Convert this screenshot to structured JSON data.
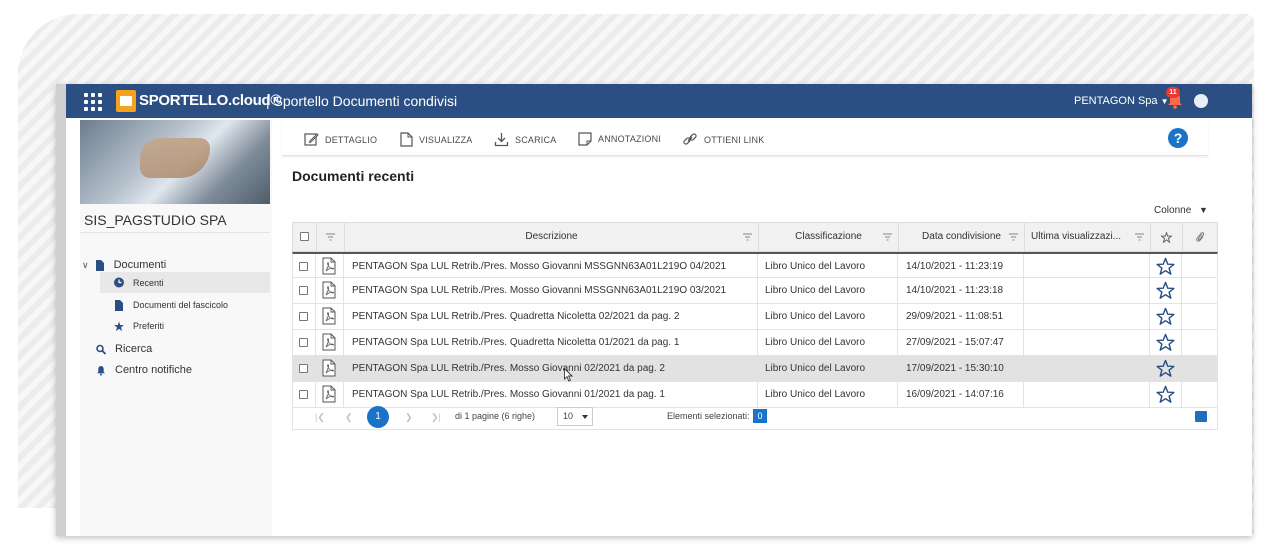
{
  "header": {
    "brand": "SPORTELLO.cloud®",
    "app_title": "| Sportello Documenti condivisi",
    "company": "PENTAGON Spa",
    "notification_count": "11"
  },
  "sidebar": {
    "company_name": "SIS_PAGSTUDIO SPA",
    "items": [
      {
        "label": "Documenti"
      },
      {
        "label": "Recenti"
      },
      {
        "label": "Documenti del fascicolo"
      },
      {
        "label": "Preferiti"
      },
      {
        "label": "Ricerca"
      },
      {
        "label": "Centro notifiche"
      }
    ]
  },
  "toolbar": {
    "dettaglio": "DETTAGLIO",
    "visualizza": "VISUALIZZA",
    "scarica": "SCARICA",
    "annotazioni": "ANNOTAZIONI",
    "ottieni_link": "OTTIENI LINK",
    "help": "?"
  },
  "main": {
    "title": "Documenti recenti",
    "columns_label": "Colonne"
  },
  "table": {
    "headers": {
      "descrizione": "Descrizione",
      "classificazione": "Classificazione",
      "data": "Data condivisione",
      "ultima": "Ultima visualizzazi..."
    },
    "rows": [
      {
        "desc": "PENTAGON Spa LUL Retrib./Pres. Mosso Giovanni MSSGNN63A01L219O 04/2021",
        "class": "Libro Unico del Lavoro",
        "date": "14/10/2021 - 11:23:19",
        "last": ""
      },
      {
        "desc": "PENTAGON Spa LUL Retrib./Pres. Mosso Giovanni MSSGNN63A01L219O 03/2021",
        "class": "Libro Unico del Lavoro",
        "date": "14/10/2021 - 11:23:18",
        "last": ""
      },
      {
        "desc": "PENTAGON Spa LUL Retrib./Pres. Quadretta Nicoletta 02/2021 da pag. 2",
        "class": "Libro Unico del Lavoro",
        "date": "29/09/2021 - 11:08:51",
        "last": ""
      },
      {
        "desc": "PENTAGON Spa LUL Retrib./Pres. Quadretta Nicoletta 01/2021 da pag. 1",
        "class": "Libro Unico del Lavoro",
        "date": "27/09/2021 - 15:07:47",
        "last": ""
      },
      {
        "desc": "PENTAGON Spa LUL Retrib./Pres. Mosso Giovanni 02/2021 da pag. 2",
        "class": "Libro Unico del Lavoro",
        "date": "17/09/2021 - 15:30:10",
        "last": ""
      },
      {
        "desc": "PENTAGON Spa LUL Retrib./Pres. Mosso Giovanni 01/2021 da pag. 1",
        "class": "Libro Unico del Lavoro",
        "date": "16/09/2021 - 14:07:16",
        "last": ""
      }
    ]
  },
  "pager": {
    "current_page": "1",
    "info": "di 1 pagine (6 righe)",
    "page_size": "10",
    "selected_label": "Elementi selezionati:",
    "selected_count": "0"
  }
}
